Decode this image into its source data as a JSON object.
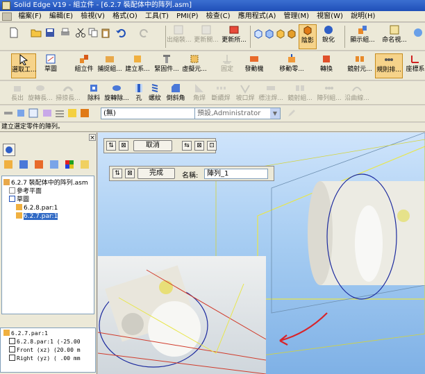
{
  "titlebar": {
    "title": "Solid Edge V19 - 組立件 - [6.2.7 裝配体中的阵列.asm]"
  },
  "menubar": {
    "items": [
      "檔案(F)",
      "編輯(E)",
      "檢視(V)",
      "格式(O)",
      "工具(T)",
      "PMI(P)",
      "檢查(C)",
      "應用程式(A)",
      "管理(M)",
      "視窗(W)",
      "說明(H)"
    ]
  },
  "toolbar1": {
    "buttons": [
      "出縮裝...",
      "更新關...",
      "更新所...",
      "陰影",
      "銳化",
      "顯示組...",
      "命名視..."
    ]
  },
  "toolbar2": {
    "buttons": [
      "選取工...",
      "草圖",
      "組立件",
      "捕捉組...",
      "建立系...",
      "緊固件...",
      "虛擬元...",
      "固定",
      "發動機",
      "移動零...",
      "轉換",
      "鏡射元...",
      "規則排...",
      "座標系"
    ]
  },
  "toolbar3": {
    "buttons": [
      "長出",
      "旋轉長...",
      "掃掠長...",
      "除料",
      "旋轉除...",
      "孔",
      "螺紋",
      "倒斜角",
      "角焊",
      "斷續焊",
      "坡口焊",
      "標注焊...",
      "鏡射組...",
      "陣列組...",
      "沿曲線..."
    ]
  },
  "toolbar4": {
    "style_combo": "(無)",
    "user_combo": "預設,Administrator"
  },
  "status": {
    "text": "建立選定零件的陣列。"
  },
  "pathfinder": {
    "tree": [
      {
        "label": "6.2.7 裝配体中的阵列.asm",
        "level": 0
      },
      {
        "label": "參考平面",
        "level": 1
      },
      {
        "label": "草圖",
        "level": 1
      },
      {
        "label": "6.2.8.par:1",
        "level": 1
      },
      {
        "label": "6.2.7.par:1",
        "level": 1,
        "selected": true
      }
    ],
    "props": [
      "6.2.7.par:1",
      "6.2.8.par:1  (-25.00",
      "Front (xz)  (20.00 m",
      "Right (yz)  ( .00 mm"
    ]
  },
  "commandbar1": {
    "cancel_label": "取消"
  },
  "commandbar2": {
    "finish_label": "完成",
    "name_label": "名稱:",
    "name_value": "陣列_1"
  }
}
